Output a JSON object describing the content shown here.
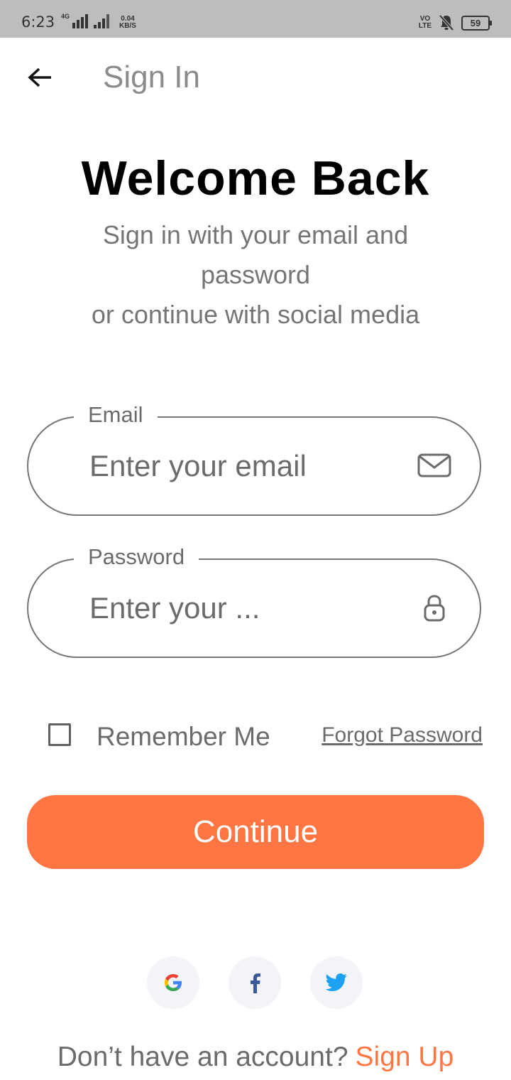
{
  "status_bar": {
    "time": "6:23",
    "network": "4G",
    "speed_value": "0.04",
    "speed_unit": "KB/S",
    "volte_line1": "VO",
    "volte_line2": "LTE",
    "battery": "59"
  },
  "header": {
    "title": "Sign In",
    "back_icon": "arrow-left-icon"
  },
  "intro": {
    "heading": "Welcome Back",
    "subtitle_line1": "Sign in with your email and",
    "subtitle_line2": "password",
    "subtitle_line3": "or continue with social media"
  },
  "form": {
    "email": {
      "label": "Email",
      "placeholder": "Enter your email",
      "value": "",
      "icon": "mail-icon"
    },
    "password": {
      "label": "Password",
      "placeholder": "Enter your ...",
      "value": "",
      "icon": "lock-icon"
    },
    "remember_label": "Remember Me",
    "remember_checked": false,
    "forgot_label": "Forgot Password",
    "continue_label": "Continue"
  },
  "social": [
    {
      "name": "google",
      "icon": "google-icon"
    },
    {
      "name": "facebook",
      "icon": "facebook-icon"
    },
    {
      "name": "twitter",
      "icon": "twitter-icon"
    }
  ],
  "footer": {
    "prompt": "Don’t have an account?",
    "signup_label": "Sign Up"
  },
  "colors": {
    "accent": "#ff7643",
    "text_muted": "#757575",
    "status_bar_bg": "#bdbdbd",
    "social_bg": "#f3f4f8",
    "facebook": "#3b5998",
    "twitter": "#1da1f2"
  }
}
